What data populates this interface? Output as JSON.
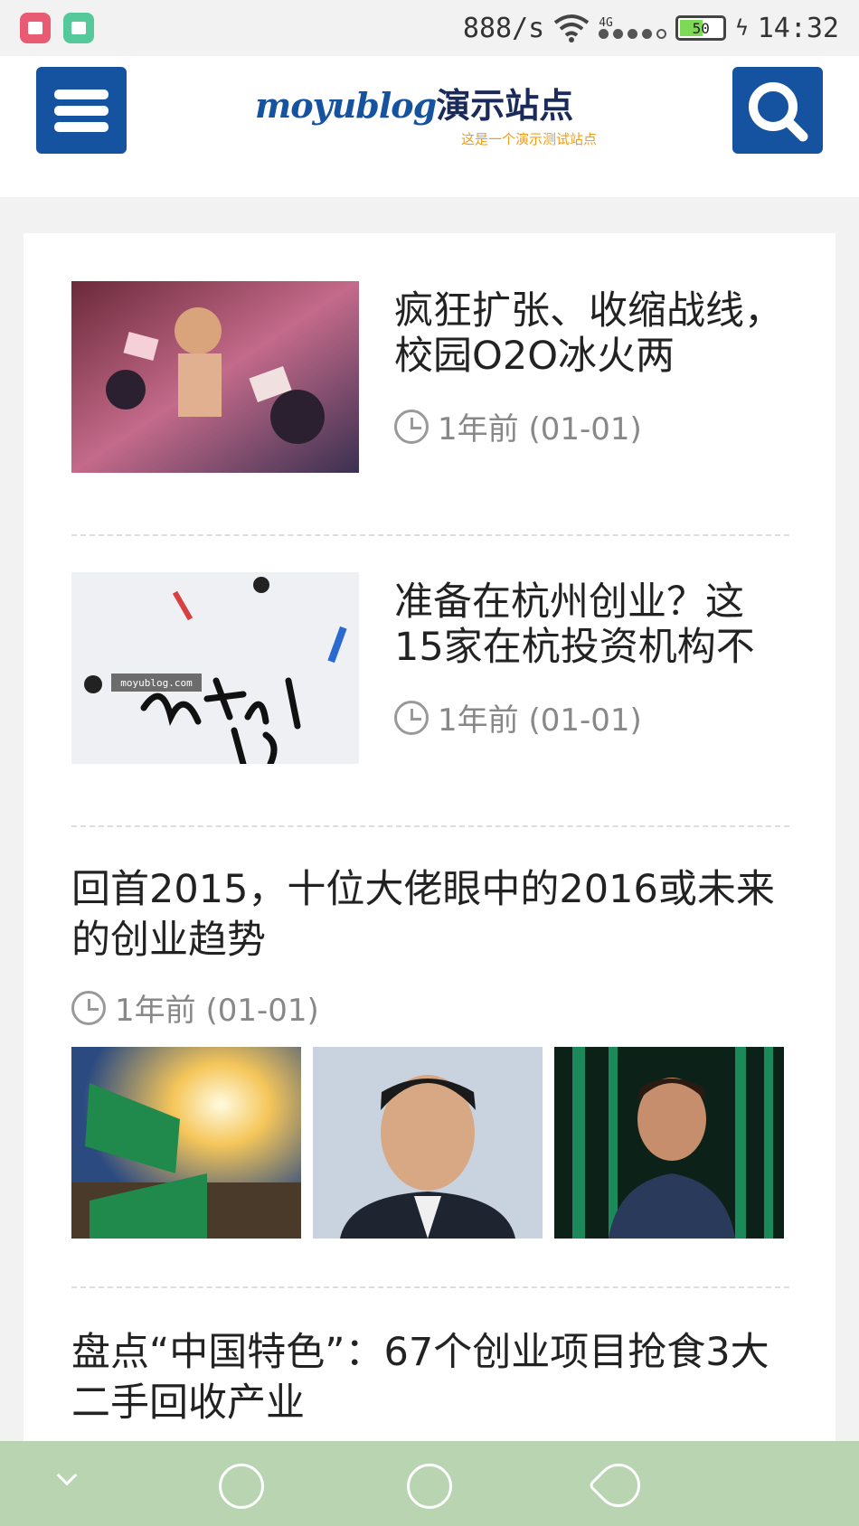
{
  "status": {
    "speed": "888/s",
    "network": "4G",
    "battery": "50",
    "time": "14:32"
  },
  "header": {
    "logo_en": "moyublog",
    "logo_cn": "演示站点",
    "tagline": "这是一个演示测试站点"
  },
  "posts": [
    {
      "title": "疯狂扩张、收缩战线，校园O2O冰火两",
      "time": "1年前 (01-01)"
    },
    {
      "title": "准备在杭州创业？这15家在杭投资机构不",
      "time": "1年前 (01-01)",
      "watermark": "moyublog.com"
    },
    {
      "title": "回首2015，十位大佬眼中的2016或未来的创业趋势",
      "time": "1年前 (01-01)"
    },
    {
      "title": "盘点“中国特色”：67个创业项目抢食3大二手回收产业"
    }
  ],
  "colors": {
    "brand": "#1553a0",
    "accent": "#f39c12",
    "nav_bar": "#b8d4b0"
  }
}
